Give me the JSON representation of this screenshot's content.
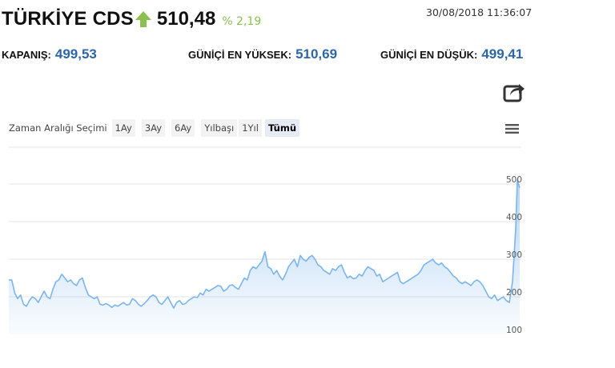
{
  "header": {
    "title": "TÜRKİYE CDS",
    "direction_icon": "arrow-up-icon",
    "price": "510,48",
    "change": "% 2,19",
    "timestamp": "30/08/2018 11:36:07"
  },
  "stats": {
    "close_label": "KAPANIŞ:",
    "close_value": "499,53",
    "high_label": "GÜNİÇİ EN YÜKSEK:",
    "high_value": "510,69",
    "low_label": "GÜNİÇİ EN DÜŞÜK:",
    "low_value": "499,41"
  },
  "toolbar": {
    "export_icon": "share-export-icon",
    "range_label": "Zaman Aralığı Seçimi",
    "range_buttons": [
      "1Ay",
      "3Ay",
      "6Ay",
      "Yılbaşı",
      "1Yıl",
      "Tümü"
    ],
    "active_range": "Tümü",
    "menu_icon": "hamburger-menu-icon"
  },
  "colors": {
    "up": "#8cc152",
    "value": "#2d66a8",
    "line": "#7cb5ec",
    "grid": "#e6e6e6"
  },
  "chart_data": {
    "type": "area",
    "x": [
      0,
      1,
      2,
      3,
      4,
      5,
      6,
      7,
      8,
      9,
      10,
      11,
      12,
      13,
      14,
      15,
      16,
      17,
      18,
      19,
      20,
      21,
      22,
      23,
      24,
      25,
      26,
      27,
      28,
      29,
      30,
      31,
      32,
      33,
      34,
      35,
      36,
      37,
      38,
      39,
      40,
      41,
      42,
      43,
      44,
      45,
      46,
      47,
      48,
      49,
      50,
      51,
      52,
      53,
      54,
      55,
      56,
      57,
      58,
      59,
      60,
      61,
      62,
      63,
      64,
      65,
      66,
      67,
      68,
      69,
      70,
      71,
      72,
      73,
      74,
      75,
      76,
      77,
      78,
      79,
      80,
      81,
      82,
      83,
      84,
      85,
      86,
      87,
      88,
      89,
      90,
      91,
      92,
      93,
      94,
      95,
      96,
      97,
      98,
      99,
      100,
      101,
      102,
      103,
      104,
      105,
      106,
      107,
      108,
      109,
      110,
      111,
      112,
      113,
      114,
      115,
      116,
      117,
      118,
      119,
      120,
      121,
      122,
      123,
      124,
      125,
      126,
      127,
      128,
      129,
      130,
      131,
      132,
      133,
      134,
      135,
      136,
      137,
      138,
      139,
      140,
      141,
      142,
      143,
      144,
      145,
      146,
      147,
      148,
      149,
      150,
      151,
      152,
      153,
      154,
      155,
      156,
      157,
      158,
      159,
      160,
      161,
      162,
      163,
      164,
      165,
      166,
      167,
      168,
      169,
      170
    ],
    "values": [
      245,
      245,
      210,
      195,
      205,
      180,
      175,
      190,
      200,
      195,
      185,
      200,
      215,
      200,
      195,
      220,
      240,
      245,
      260,
      250,
      240,
      245,
      235,
      230,
      245,
      250,
      225,
      205,
      200,
      195,
      200,
      180,
      178,
      182,
      178,
      172,
      178,
      175,
      180,
      185,
      178,
      180,
      195,
      190,
      180,
      175,
      182,
      190,
      200,
      205,
      200,
      185,
      180,
      190,
      200,
      185,
      170,
      185,
      190,
      180,
      182,
      190,
      195,
      200,
      198,
      210,
      205,
      220,
      215,
      220,
      225,
      230,
      228,
      215,
      220,
      230,
      232,
      225,
      220,
      235,
      250,
      245,
      270,
      280,
      275,
      285,
      295,
      320,
      280,
      275,
      260,
      270,
      255,
      245,
      260,
      280,
      290,
      300,
      280,
      310,
      300,
      295,
      305,
      310,
      300,
      285,
      280,
      270,
      265,
      260,
      275,
      270,
      280,
      285,
      265,
      250,
      255,
      248,
      250,
      260,
      255,
      270,
      280,
      275,
      270,
      255,
      260,
      240,
      245,
      250,
      255,
      260,
      265,
      240,
      235,
      240,
      245,
      250,
      255,
      260,
      270,
      285,
      290,
      295,
      300,
      290,
      285,
      290,
      280,
      275,
      265,
      255,
      250,
      240,
      235,
      240,
      235,
      230,
      240,
      245,
      240,
      230,
      215,
      200,
      195,
      205,
      190,
      195,
      200,
      190,
      185
    ]
  }
}
